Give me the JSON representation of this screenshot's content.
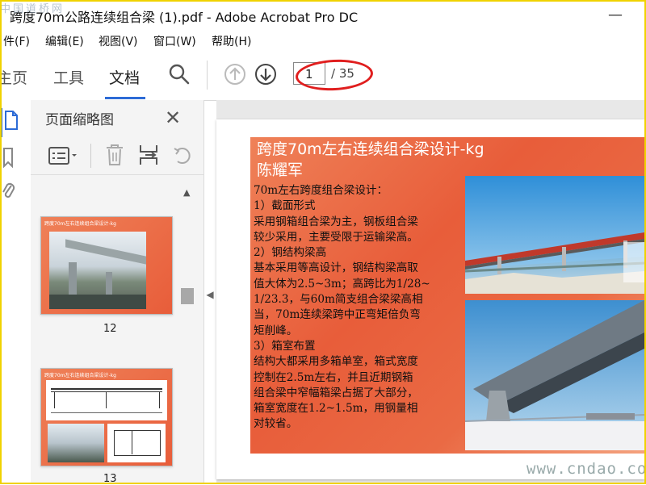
{
  "window": {
    "title": "跨度70m公路连续组合梁 (1).pdf - Adobe Acrobat Pro DC",
    "watermark_top": "中国道桥网",
    "watermark_bottom": "www.cndao.com"
  },
  "menu": [
    "件(F)",
    "编辑(E)",
    "视图(V)",
    "窗口(W)",
    "帮助(H)"
  ],
  "toolbar": {
    "tabs": [
      "主页",
      "工具",
      "文档"
    ],
    "active_tab": "文档",
    "page_current": "1",
    "page_total": "/ 35"
  },
  "panel": {
    "title": "页面缩略图",
    "thumbnails": [
      {
        "label": "12",
        "heading": "跨度70m左右连续组合梁设计-kg"
      },
      {
        "label": "13",
        "heading": "跨度70m左右连续组合梁设计-kg"
      }
    ]
  },
  "slide": {
    "title_line1": "跨度70m左右连续组合梁设计-kg",
    "title_line2": "陈耀军",
    "body": [
      "70m左右跨度组合梁设计：",
      "1）截面形式",
      "采用钢箱组合梁为主，钢板组合梁",
      "较少采用，主要受限于运输梁高。",
      "2）钢结构梁高",
      "基本采用等高设计，钢结构梁高取",
      "值大体为2.5~3m；高跨比为1/28~",
      "1/23.3，与60m简支组合梁梁高相",
      "当，70m连续梁跨中正弯矩倍负弯",
      "矩削峰。",
      "3）箱室布置",
      "结构大都采用多箱单室，箱式宽度",
      "控制在2.5m左右，并且近期钢箱",
      "组合梁中窄幅箱梁占据了大部分，",
      "箱室宽度在1.2~1.5m，用钢量相",
      "对较省。"
    ]
  },
  "colors": {
    "accent": "#2d6bd6",
    "highlight": "#e01e1e",
    "slide_bg": "#e85d3a"
  }
}
